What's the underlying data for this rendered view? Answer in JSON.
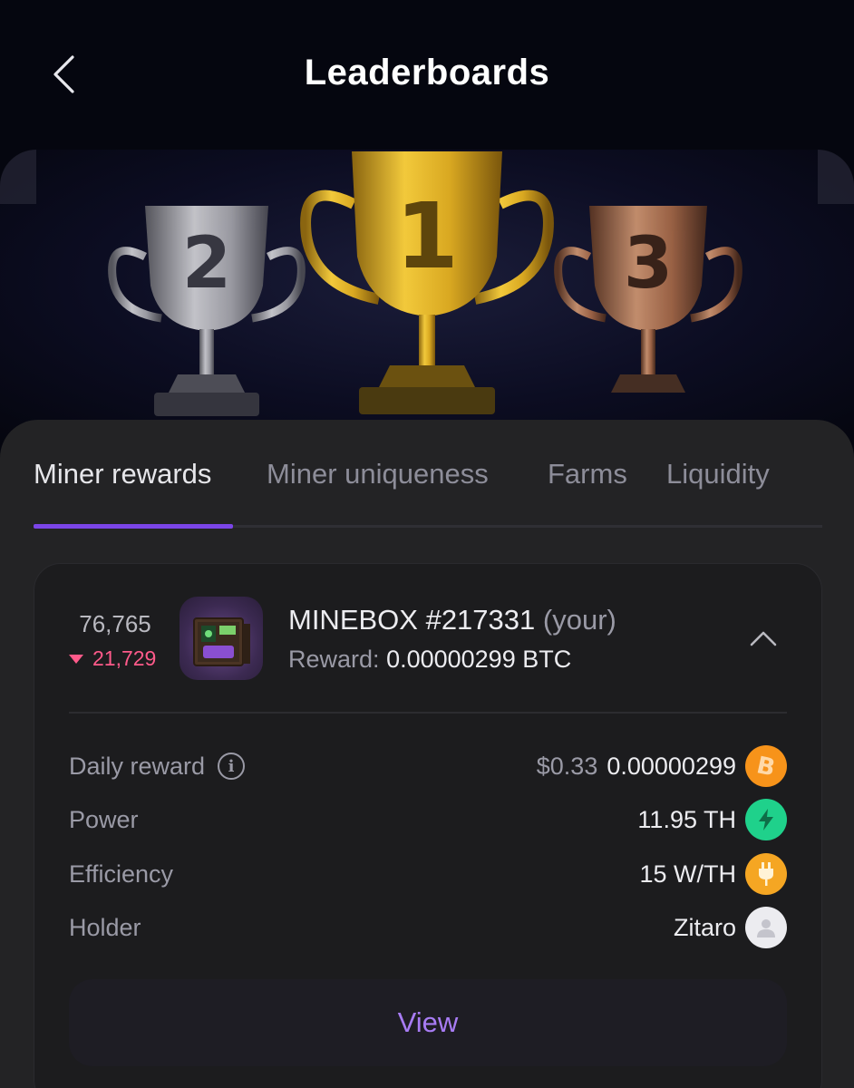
{
  "header": {
    "title": "Leaderboards",
    "back_icon": "chevron-left-icon"
  },
  "hero": {
    "trophies": [
      {
        "rank_label": "2",
        "metal": "silver",
        "color": "#b4b4b8"
      },
      {
        "rank_label": "1",
        "metal": "gold",
        "color": "#d9a821"
      },
      {
        "rank_label": "3",
        "metal": "bronze",
        "color": "#b87a55"
      }
    ]
  },
  "tabs": [
    {
      "label": "Miner rewards",
      "active": true
    },
    {
      "label": "Miner uniqueness",
      "active": false
    },
    {
      "label": "Farms",
      "active": false
    },
    {
      "label": "Liquidity",
      "active": false
    }
  ],
  "miner": {
    "rank": "76,765",
    "rank_change": "21,729",
    "rank_change_direction": "down",
    "name": "MINEBOX #217331",
    "owner_tag": "(your)",
    "reward_label": "Reward:",
    "reward_value": "0.00000299 BTC"
  },
  "details": {
    "daily_reward": {
      "label": "Daily reward",
      "usd": "$0.33",
      "value": "0.00000299",
      "icon": "bitcoin-icon"
    },
    "power": {
      "label": "Power",
      "value": "11.95 TH",
      "icon": "lightning-icon"
    },
    "efficiency": {
      "label": "Efficiency",
      "value": "15 W/TH",
      "icon": "plug-icon"
    },
    "holder": {
      "label": "Holder",
      "value": "Zitaro",
      "icon": "user-avatar-icon"
    }
  },
  "actions": {
    "view_label": "View"
  },
  "colors": {
    "accent": "#7b45e8",
    "view_text": "#a87cf4",
    "rank_down": "#ff5a8a",
    "bitcoin": "#f7931a",
    "power": "#1fd18b",
    "efficiency": "#f5a623"
  }
}
